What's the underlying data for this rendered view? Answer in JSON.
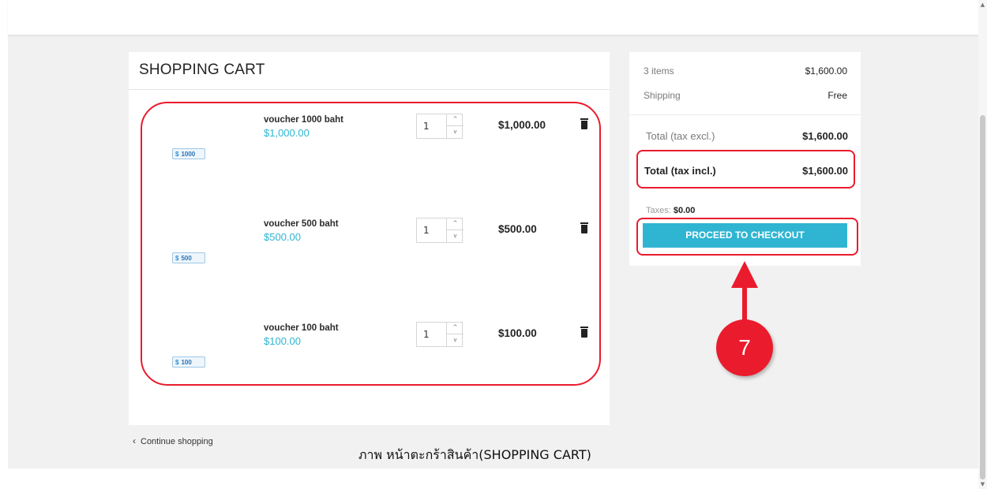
{
  "cart": {
    "title": "SHOPPING CART",
    "items": [
      {
        "name": "voucher 1000 baht",
        "unit_price": "$1,000.00",
        "qty": "1",
        "total": "$1,000.00",
        "thumb_label": "1000"
      },
      {
        "name": "voucher 500 baht",
        "unit_price": "$500.00",
        "qty": "1",
        "total": "$500.00",
        "thumb_label": "500"
      },
      {
        "name": "voucher 100 baht",
        "unit_price": "$100.00",
        "qty": "1",
        "total": "$100.00",
        "thumb_label": "100"
      }
    ],
    "continue_label": "Continue shopping"
  },
  "summary": {
    "items_label": "3 items",
    "items_value": "$1,600.00",
    "shipping_label": "Shipping",
    "shipping_value": "Free",
    "total_excl_label": "Total (tax excl.)",
    "total_excl_value": "$1,600.00",
    "total_incl_label": "Total (tax incl.)",
    "total_incl_value": "$1,600.00",
    "taxes_label": "Taxes:",
    "taxes_value": "$0.00",
    "checkout_label": "PROCEED TO CHECKOUT"
  },
  "annotation": {
    "step_number": "7",
    "caption": "ภาพ หน้าตะกร้าสินค้า(SHOPPING CART)",
    "highlight_color": "#ea1b2c"
  },
  "colors": {
    "accent": "#2fb5d2"
  }
}
